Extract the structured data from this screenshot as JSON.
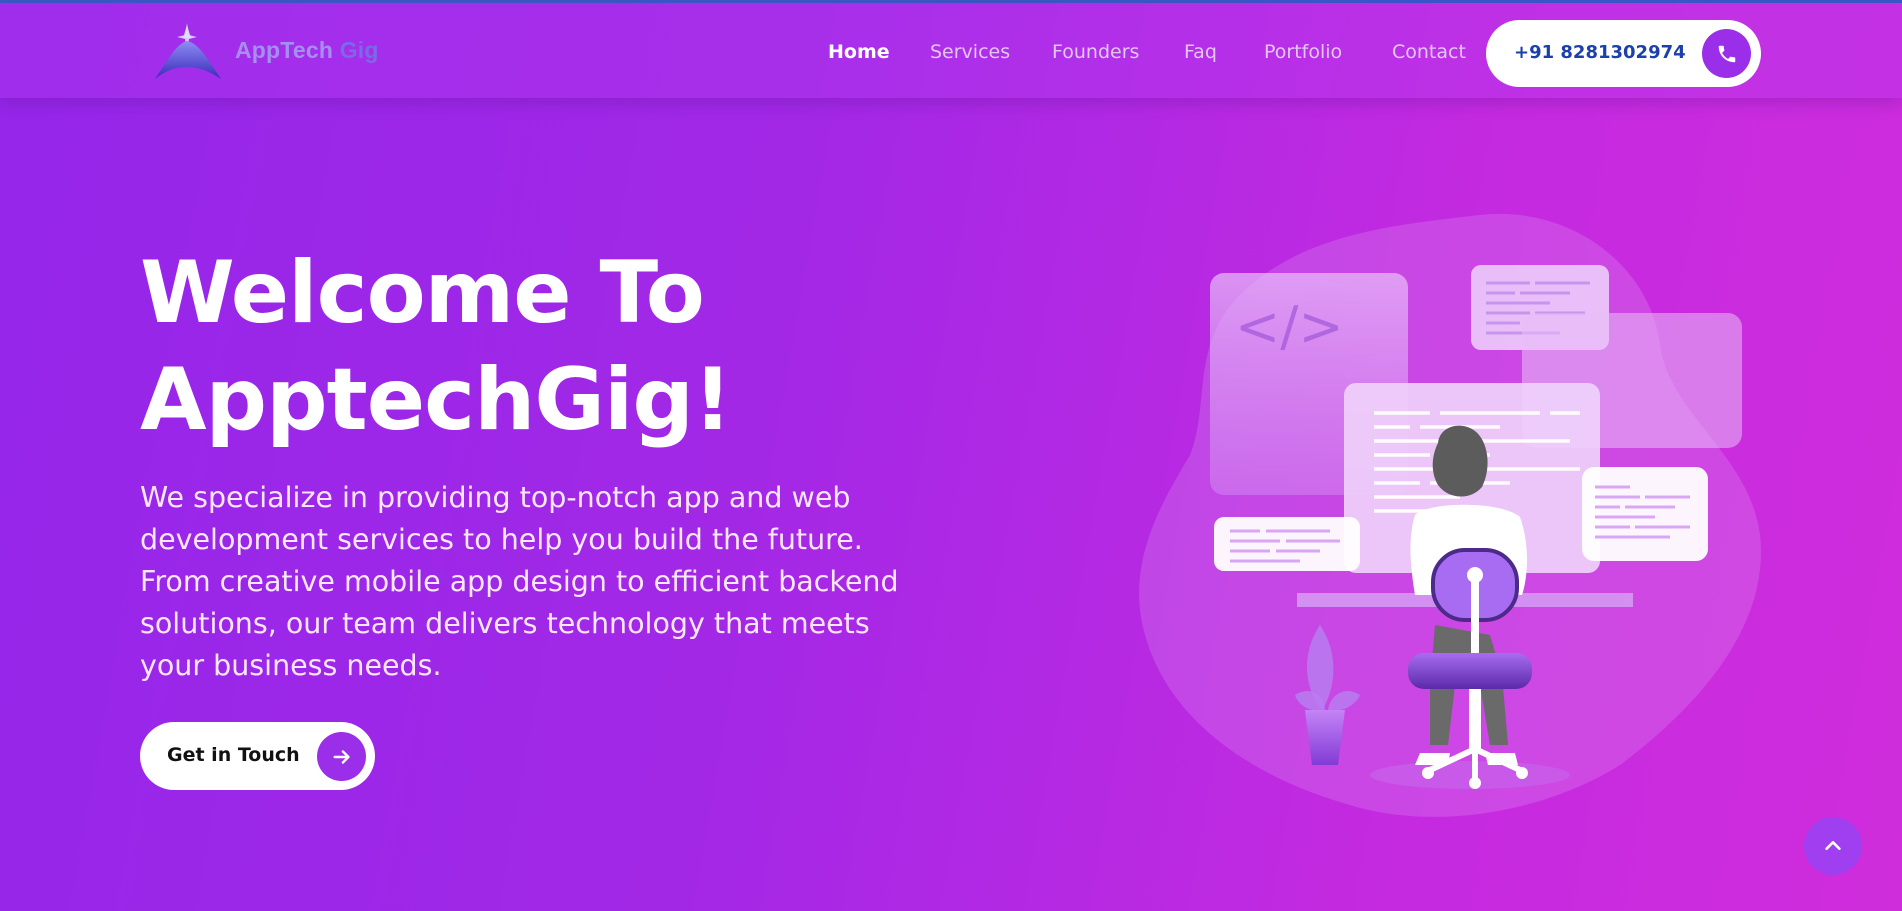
{
  "header": {
    "logo": {
      "text_main": "AppTech",
      "text_accent": "Gig"
    },
    "nav": [
      {
        "label": "Home",
        "active": true
      },
      {
        "label": "Services",
        "active": false
      },
      {
        "label": "Founders",
        "active": false
      },
      {
        "label": "Faq",
        "active": false
      },
      {
        "label": "Portfolio",
        "active": false
      },
      {
        "label": "Contact",
        "active": false
      }
    ],
    "phone": {
      "number": "+91 8281302974",
      "icon": "phone-icon"
    }
  },
  "hero": {
    "title_line1": "Welcome To",
    "title_line2": "ApptechGig!",
    "description": "We specialize in providing top-notch app and web development services to help you build the future. From creative mobile app design to efficient backend solutions, our team delivers technology that meets your business needs.",
    "cta_label": "Get in Touch",
    "cta_icon": "arrow-right-icon",
    "illustration_code_glyph": "</>"
  },
  "scroll_top": {
    "icon": "chevron-up-icon"
  },
  "colors": {
    "accent": "#9b2fe9",
    "phone_text": "#1c3fae",
    "background_start": "#9526ea",
    "background_end": "#cf2ddc"
  }
}
